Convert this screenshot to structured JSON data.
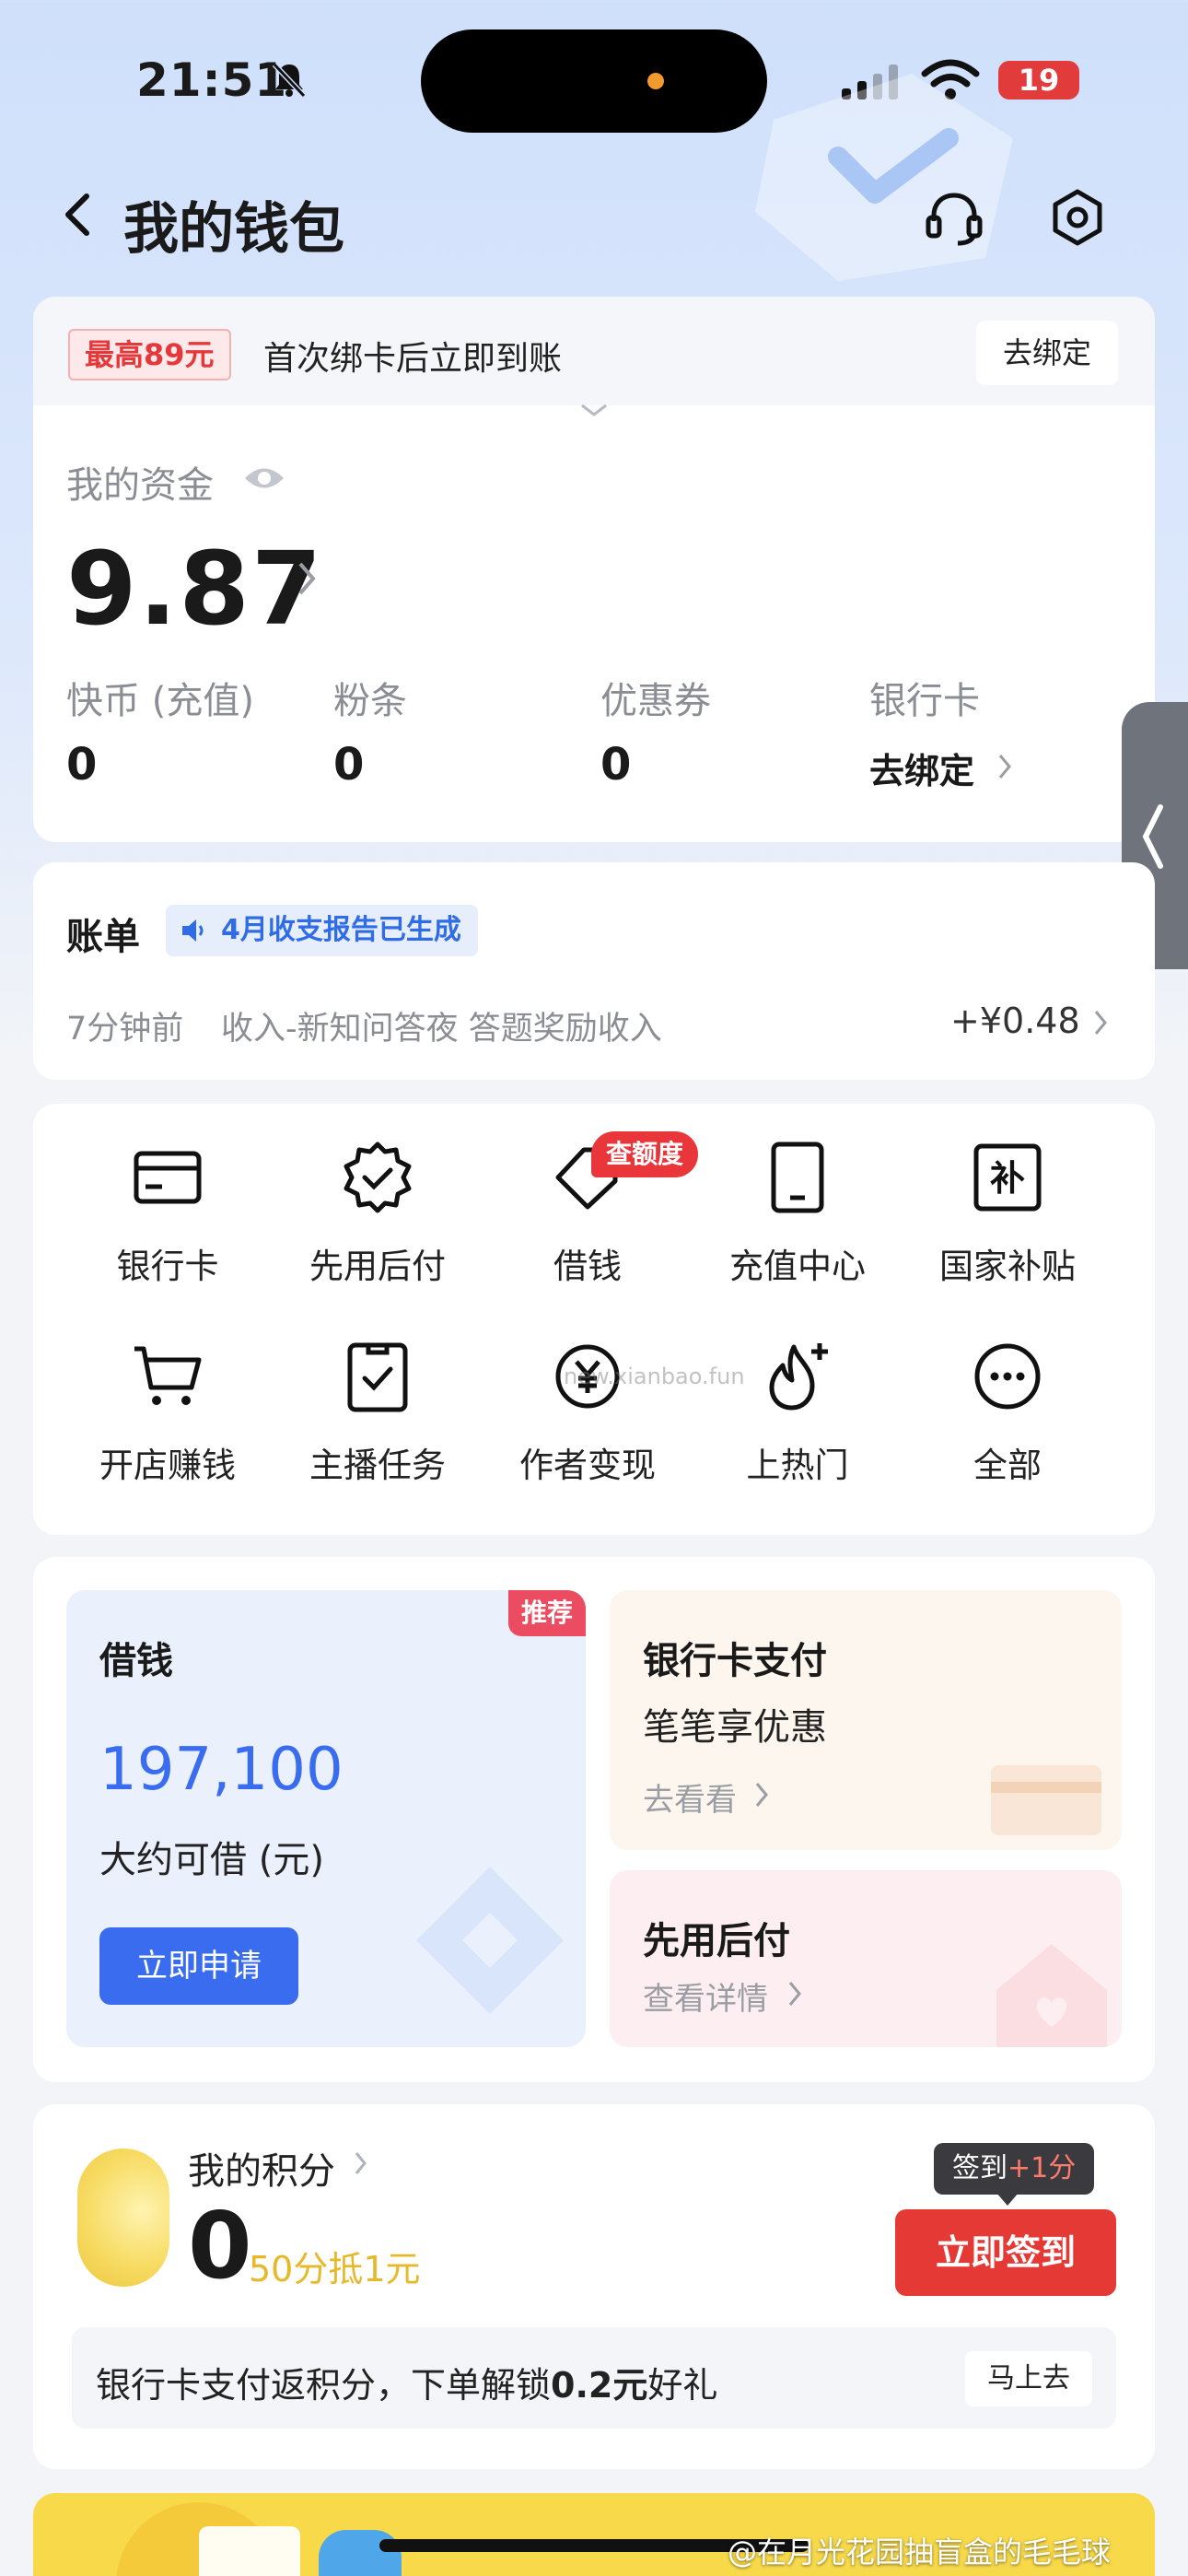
{
  "status_bar": {
    "time": "21:51",
    "battery": "19"
  },
  "header": {
    "title": "我的钱包"
  },
  "promo": {
    "badge": "最高89元",
    "text": "首次绑卡后立即到账",
    "button": "去绑定"
  },
  "assets": {
    "label": "我的资金",
    "value": "9.87",
    "items": [
      {
        "label": "快币 (充值)",
        "value": "0"
      },
      {
        "label": "粉条",
        "value": "0"
      },
      {
        "label": "优惠券",
        "value": "0"
      },
      {
        "label": "银行卡",
        "value": "去绑定"
      }
    ]
  },
  "bill": {
    "title": "账单",
    "tag": "4月收支报告已生成",
    "time": "7分钟前",
    "desc": "收入-新知问答夜 答题奖励收入",
    "amount": "+¥0.48"
  },
  "services": {
    "hot_badge": "查额度",
    "items": [
      {
        "label": "银行卡",
        "icon": "bank-card-icon"
      },
      {
        "label": "先用后付",
        "icon": "verified-badge-icon"
      },
      {
        "label": "借钱",
        "icon": "tag-icon"
      },
      {
        "label": "充值中心",
        "icon": "phone-icon"
      },
      {
        "label": "国家补贴",
        "icon": "subsidy-icon"
      },
      {
        "label": "开店赚钱",
        "icon": "cart-icon"
      },
      {
        "label": "主播任务",
        "icon": "clipboard-check-icon"
      },
      {
        "label": "作者变现",
        "icon": "yuan-coin-icon"
      },
      {
        "label": "上热门",
        "icon": "flame-plus-icon"
      },
      {
        "label": "全部",
        "icon": "more-icon"
      }
    ]
  },
  "finance": {
    "loan": {
      "title": "借钱",
      "badge": "推荐",
      "amount": "197,100",
      "subtitle": "大约可借 (元)",
      "button": "立即申请"
    },
    "bank_pay": {
      "title": "银行卡支付",
      "subtitle": "笔笔享优惠",
      "link": "去看看"
    },
    "pay_later": {
      "title": "先用后付",
      "link": "查看详情"
    }
  },
  "points": {
    "title": "我的积分",
    "value": "0",
    "hint": "50分抵1元",
    "tip_prefix": "签到",
    "tip_bonus": "+1分",
    "button": "立即签到",
    "strip_pre": "银行卡支付返积分，下单解锁",
    "strip_bold": "0.2元",
    "strip_post": "好礼",
    "strip_button": "马上去"
  },
  "watermark": "new.xianbao.fun",
  "credit": "@在月光花园抽盲盒的毛毛球",
  "colors": {
    "accent_blue": "#3a6cf0",
    "accent_red": "#e53935",
    "points_gold": "#e7b92a"
  }
}
